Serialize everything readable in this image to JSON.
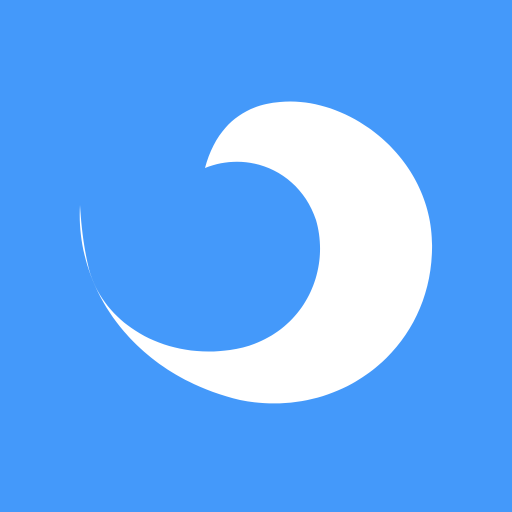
{
  "icon": {
    "name": "crescent-swirl-logo",
    "background_color": "#4499FA",
    "mark_color": "#FFFFFF"
  }
}
